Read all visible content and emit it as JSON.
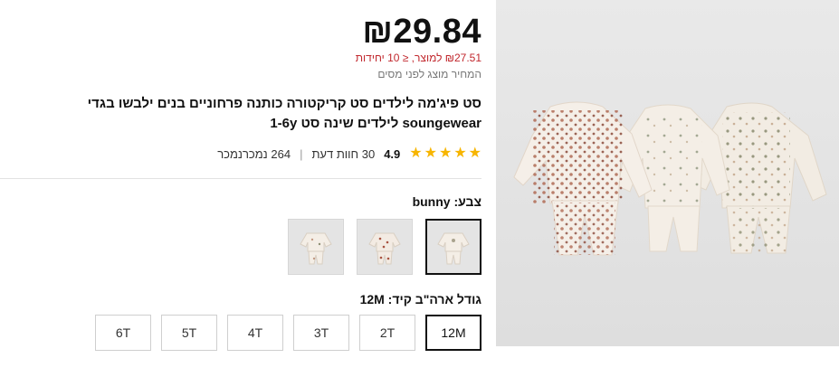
{
  "product": {
    "price": "₪29.84",
    "unit_price_note": "₪27.51 למוצר, ≤ 10 יחידות",
    "vat_note": "המחיר מוצג לפני מסים",
    "title": "סט פיג'מה לילדים סט קריקטורה כותנה פרחוניים בנים ילבשו בגדי soungewear לילדים שינה סט 1-6y",
    "rating": "4.9",
    "stars": 5,
    "reviews": "30 חוות דעת",
    "sold": "264 נמכרנמכר",
    "separator": "|"
  },
  "color": {
    "label": "צבע: bunny",
    "options": [
      {
        "name": "bunny",
        "selected": true
      },
      {
        "name": "floral-red",
        "selected": false
      },
      {
        "name": "floral-small",
        "selected": false
      }
    ]
  },
  "size": {
    "label": "גודל ארה\"ב קיד: 12M",
    "options": [
      "12M",
      "2T",
      "3T",
      "4T",
      "5T",
      "6T"
    ],
    "selected": "12M"
  },
  "colors": {
    "accent": "#c1272d",
    "star": "#f7b500",
    "selected_border": "#111111"
  }
}
